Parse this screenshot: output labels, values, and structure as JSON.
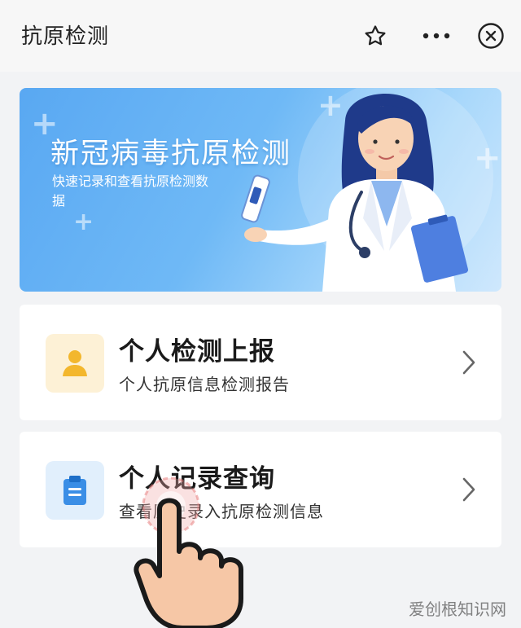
{
  "header": {
    "title": "抗原检测",
    "star_icon": "star-icon",
    "more_icon": "more-dots-icon",
    "close_icon": "close-circle-icon"
  },
  "banner": {
    "title": "新冠病毒抗原检测",
    "subtitle": "快速记录和查看抗原检测数据",
    "illustration": "doctor-holding-test-kit"
  },
  "cards": [
    {
      "title": "个人检测上报",
      "description": "个人抗原信息检测报告",
      "icon": "person-icon",
      "icon_bg": "#fdf1d6",
      "icon_color": "#f3b72d"
    },
    {
      "title": "个人记录查询",
      "description": "查看历史录入抗原检测信息",
      "icon": "clipboard-icon",
      "icon_bg": "#e1effc",
      "icon_color": "#3a8ee6"
    }
  ],
  "watermark": "爱创根知识网",
  "colors": {
    "banner_start": "#59a8f2",
    "banner_end": "#cfe8fd",
    "page_bg": "#f2f3f5"
  }
}
